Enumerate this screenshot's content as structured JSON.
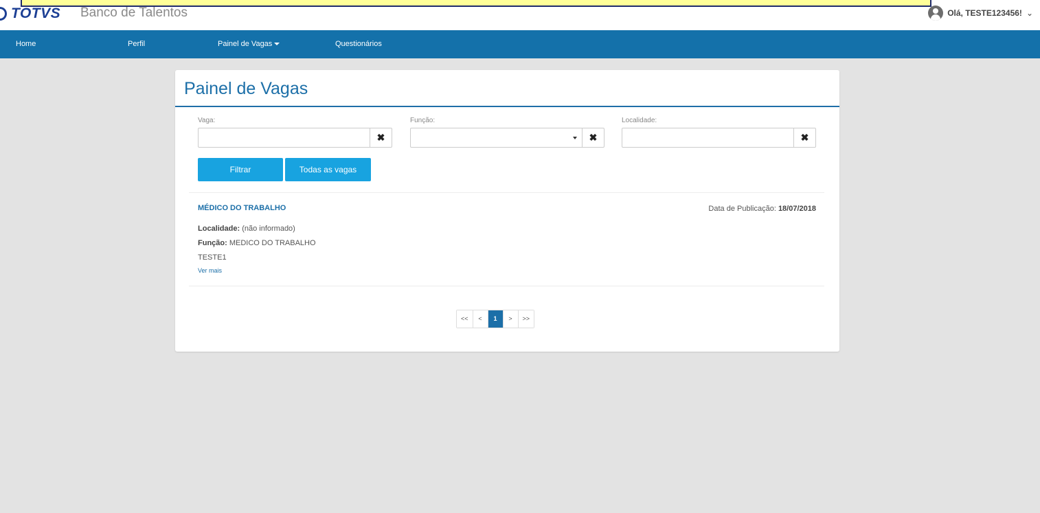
{
  "header": {
    "logo_text": "TOTVS",
    "app_title": "Banco de Talentos",
    "user_greeting": "Olá, TESTE123456!"
  },
  "nav": {
    "items": [
      "Home",
      "Perfil",
      "Painel de Vagas",
      "Questionários"
    ]
  },
  "panel": {
    "title": "Painel de Vagas",
    "filters": {
      "vaga_label": "Vaga:",
      "funcao_label": "Função:",
      "localidade_label": "Localidade:",
      "vaga_value": "",
      "funcao_value": "",
      "localidade_value": ""
    },
    "buttons": {
      "filter": "Filtrar",
      "all": "Todas as vagas"
    },
    "job": {
      "title": "MÉDICO DO TRABALHO",
      "pub_date_label": "Data de Publicação:",
      "pub_date_value": "18/07/2018",
      "locality_label": "Localidade:",
      "locality_value": "(não informado)",
      "function_label": "Função:",
      "function_value": "MEDICO DO TRABALHO",
      "description": "TESTE1",
      "more_link": "Ver mais"
    },
    "pagination": {
      "first": "<<",
      "prev": "<",
      "current": "1",
      "next": ">",
      "last": ">>"
    }
  },
  "colors": {
    "navbar": "#1471aa",
    "primary_text": "#1c6fa8",
    "button": "#18a3e0",
    "background": "#e3e3e3"
  }
}
